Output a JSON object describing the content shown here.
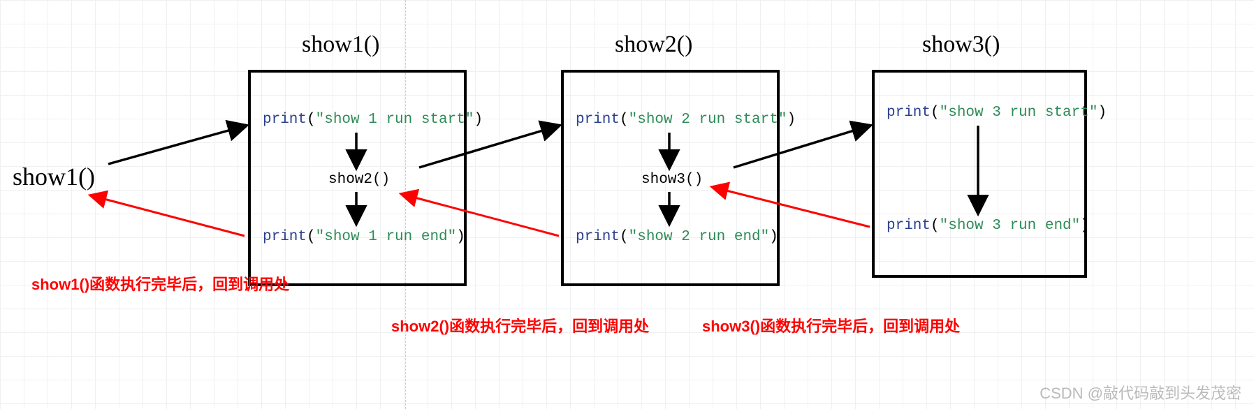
{
  "entry_label": "show1()",
  "boxes": {
    "b1": {
      "title": "show1()",
      "line_start_fn": "print",
      "line_start_str": "\"show 1 run start\"",
      "call": "show2()",
      "line_end_fn": "print",
      "line_end_str": "\"show 1 run end\""
    },
    "b2": {
      "title": "show2()",
      "line_start_fn": "print",
      "line_start_str": "\"show 2 run start\"",
      "call": "show3()",
      "line_end_fn": "print",
      "line_end_str": "\"show 2 run end\""
    },
    "b3": {
      "title": "show3()",
      "line_start_fn": "print",
      "line_start_str": "\"show 3 run start\"",
      "line_end_fn": "print",
      "line_end_str": "\"show 3 run end\""
    }
  },
  "returns": {
    "r1": "show1()函数执行完毕后，回到调用处",
    "r2": "show2()函数执行完毕后，回到调用处",
    "r3": "show3()函数执行完毕后，回到调用处"
  },
  "watermark": "CSDN @敲代码敲到头发茂密"
}
